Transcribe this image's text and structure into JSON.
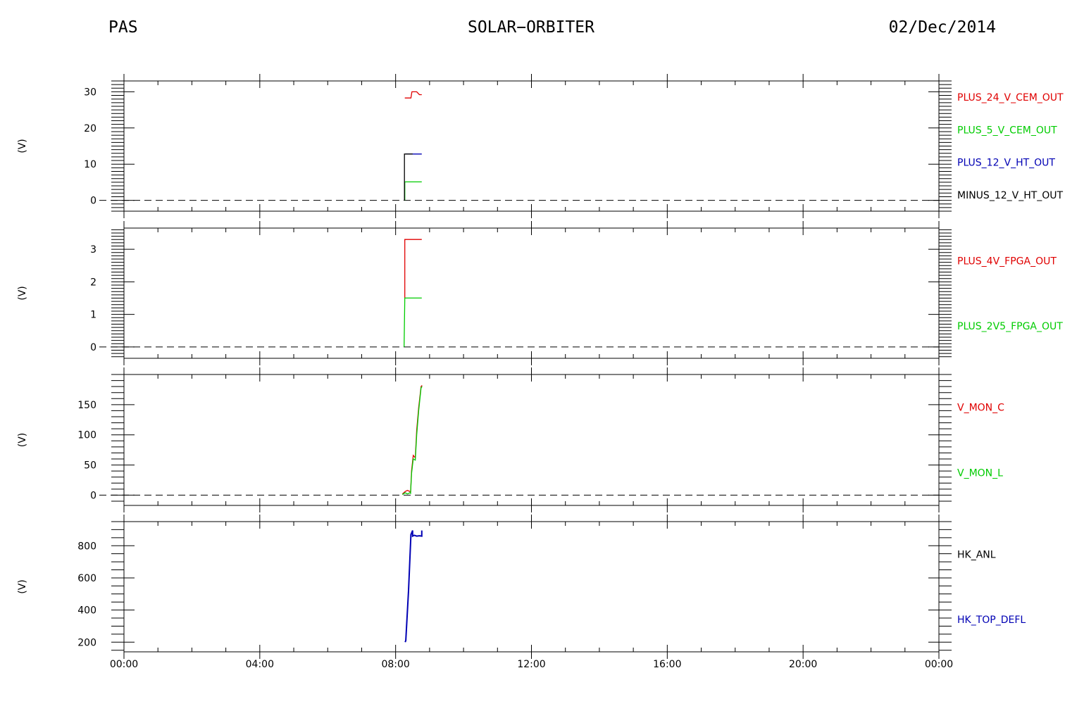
{
  "header": {
    "left": "PAS",
    "center": "SOLAR−ORBITER",
    "right": "02/Dec/2014"
  },
  "colors": {
    "red": "#e00000",
    "green": "#00cc00",
    "blue": "#0000b4",
    "black": "#000000"
  },
  "chart_data": [
    {
      "type": "line",
      "ylabel": "(V)",
      "ylim": [
        -3,
        33
      ],
      "yticks": [
        0,
        10,
        20,
        30
      ],
      "ytick_labels": [
        "0",
        "10",
        "20",
        "30"
      ],
      "minor_step": 1,
      "xlim": [
        0,
        24
      ],
      "zero_line": true,
      "series": [
        {
          "name": "PLUS_24_V_CEM_OUT",
          "color": "red",
          "x": [
            8.27,
            8.45,
            8.48,
            8.55,
            8.62,
            8.7,
            8.77
          ],
          "y": [
            28.3,
            28.3,
            30.0,
            30.0,
            30.0,
            29.2,
            29.2
          ]
        },
        {
          "name": "PLUS_5_V_CEM_OUT",
          "color": "green",
          "x": [
            8.27,
            8.27,
            8.77
          ],
          "y": [
            0,
            5.1,
            5.1
          ]
        },
        {
          "name": "PLUS_12_V_HT_OUT",
          "color": "blue",
          "x": [
            8.3,
            8.77
          ],
          "y": [
            12.8,
            12.8
          ]
        },
        {
          "name": "MINUS_12_V_HT_OUT",
          "color": "black",
          "x": [
            8.26,
            8.26,
            8.5
          ],
          "y": [
            0,
            12.8,
            12.8
          ]
        }
      ]
    },
    {
      "type": "line",
      "ylabel": "(V)",
      "ylim": [
        -0.35,
        3.65
      ],
      "yticks": [
        0,
        1,
        2,
        3
      ],
      "ytick_labels": [
        "0",
        "1",
        "2",
        "3"
      ],
      "minor_step": 0.1,
      "xlim": [
        0,
        24
      ],
      "zero_line": true,
      "series": [
        {
          "name": "PLUS_4V_FPGA_OUT",
          "color": "red",
          "x": [
            8.27,
            8.27,
            8.77
          ],
          "y": [
            1.5,
            3.3,
            3.3
          ]
        },
        {
          "name": "PLUS_2V5_FPGA_OUT",
          "color": "green",
          "x": [
            8.25,
            8.27,
            8.77
          ],
          "y": [
            0,
            1.5,
            1.5
          ]
        }
      ]
    },
    {
      "type": "line",
      "ylabel": "(V)",
      "ylim": [
        -17,
        200
      ],
      "yticks": [
        0,
        50,
        100,
        150
      ],
      "ytick_labels": [
        "0",
        "50",
        "100",
        "150"
      ],
      "minor_step": 10,
      "xlim": [
        0,
        24
      ],
      "zero_line": true,
      "series": [
        {
          "name": "V_MON_C",
          "color": "red",
          "x": [
            8.2,
            8.28,
            8.35,
            8.42,
            8.44,
            8.47,
            8.52,
            8.58,
            8.62,
            8.68,
            8.75,
            8.78
          ],
          "y": [
            2,
            6,
            8,
            6,
            5,
            40,
            66,
            62,
            108,
            145,
            180,
            182
          ]
        },
        {
          "name": "V_MON_L",
          "color": "green",
          "x": [
            8.2,
            8.28,
            8.35,
            8.42,
            8.44,
            8.47,
            8.52,
            8.58,
            8.62,
            8.68,
            8.75,
            8.78
          ],
          "y": [
            1,
            4,
            2,
            4,
            3,
            36,
            60,
            58,
            100,
            140,
            178,
            180
          ]
        }
      ]
    },
    {
      "type": "line",
      "ylabel": "(V)",
      "ylim": [
        140,
        950
      ],
      "yticks": [
        200,
        400,
        600,
        800
      ],
      "ytick_labels": [
        "200",
        "400",
        "600",
        "800"
      ],
      "minor_step": 50,
      "xlim": [
        0,
        24
      ],
      "zero_line": false,
      "x_tick_labels": [
        "00:00",
        "04:00",
        "08:00",
        "12:00",
        "16:00",
        "20:00",
        "00:00"
      ],
      "series": [
        {
          "name": "HK_ANL",
          "color": "black",
          "x": [],
          "y": []
        },
        {
          "name": "HK_TOP_DEFL",
          "color": "blue",
          "x": [
            8.28,
            8.3,
            8.38,
            8.45,
            8.5,
            8.5,
            8.55,
            8.62,
            8.7,
            8.77,
            8.77,
            8.77
          ],
          "y": [
            200,
            210,
            520,
            870,
            895,
            860,
            865,
            860,
            862,
            860,
            895,
            870
          ]
        }
      ]
    }
  ]
}
